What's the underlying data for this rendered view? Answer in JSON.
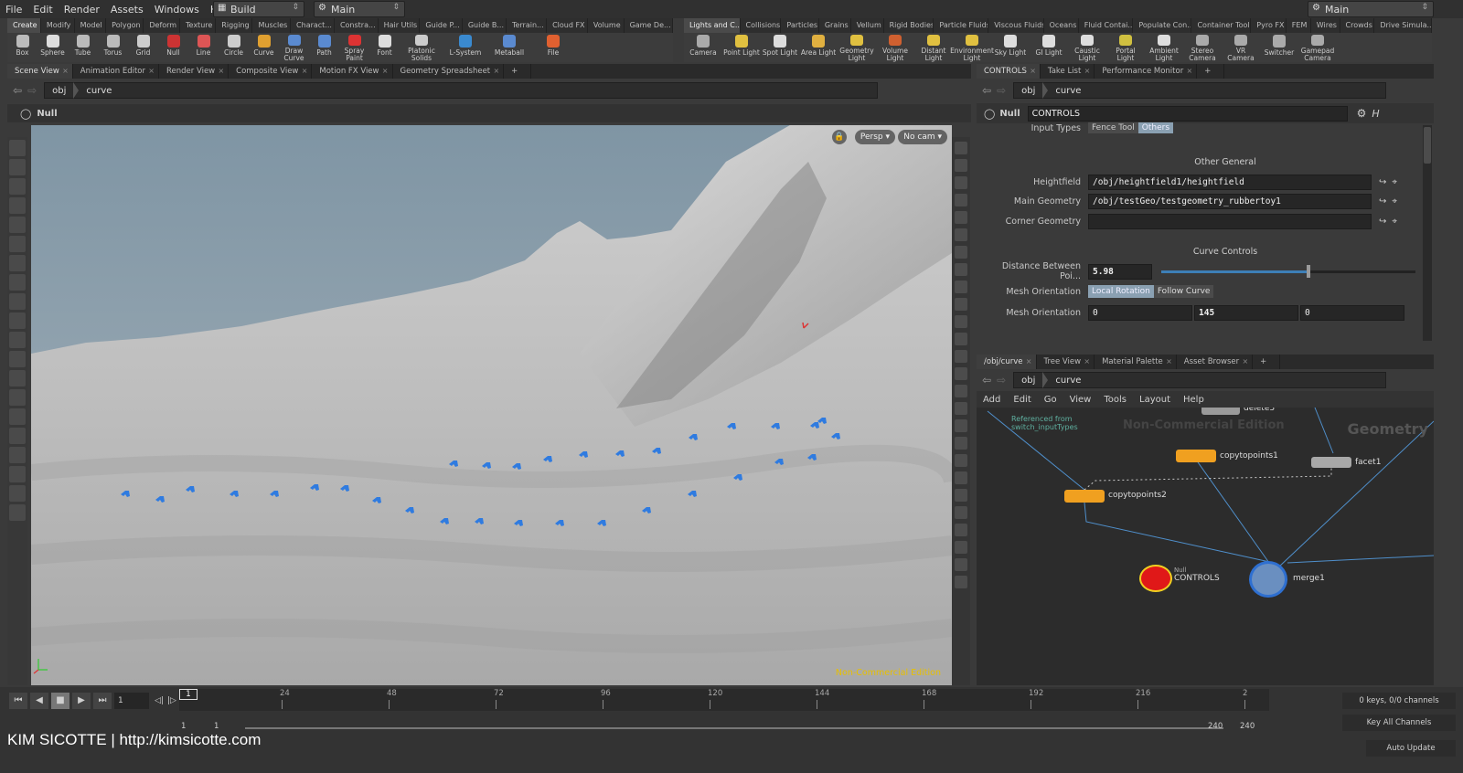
{
  "menu": [
    "File",
    "Edit",
    "Render",
    "Assets",
    "Windows",
    "Help"
  ],
  "desktop_dd": "Build",
  "context_dd": "Main",
  "right_dd": "Main",
  "shelf_left_tabs": [
    "Create",
    "Modify",
    "Model",
    "Polygon",
    "Deform",
    "Texture",
    "Rigging",
    "Muscles",
    "Charact...",
    "Constra...",
    "Hair Utils",
    "Guide P...",
    "Guide B...",
    "Terrain...",
    "Cloud FX",
    "Volume",
    "Game De..."
  ],
  "shelf_right_tabs": [
    "Lights and C...",
    "Collisions",
    "Particles",
    "Grains",
    "Vellum",
    "Rigid Bodies",
    "Particle Fluids",
    "Viscous Fluids",
    "Oceans",
    "Fluid Contai...",
    "Populate Con...",
    "Container Tools",
    "Pyro FX",
    "FEM",
    "Wires",
    "Crowds",
    "Drive Simula..."
  ],
  "tools_left": [
    "Box",
    "Sphere",
    "Tube",
    "Torus",
    "Grid",
    "Null",
    "Line",
    "Circle",
    "Curve",
    "Draw Curve",
    "Path",
    "Spray Paint",
    "Font",
    "Platonic Solids",
    "L-System",
    "Metaball",
    "File"
  ],
  "tools_right": [
    "Camera",
    "Point Light",
    "Spot Light",
    "Area Light",
    "Geometry Light",
    "Volume Light",
    "Distant Light",
    "Environment Light",
    "Sky Light",
    "GI Light",
    "Caustic Light",
    "Portal Light",
    "Ambient Light",
    "Stereo Camera",
    "VR Camera",
    "Switcher",
    "Gamepad Camera"
  ],
  "scene_tabs": [
    "Scene View",
    "Animation Editor",
    "Render View",
    "Composite View",
    "Motion FX View",
    "Geometry Spreadsheet"
  ],
  "path_obj": "obj",
  "path_curve": "curve",
  "viewer_op": "Null",
  "persp": "Persp ▾",
  "nocam": "No cam ▾",
  "watermark": "Non-Commercial Edition",
  "params_tabs": [
    "CONTROLS",
    "Take List",
    "Performance Monitor"
  ],
  "node_type": "Null",
  "node_name": "CONTROLS",
  "input_types_label": "Input Types",
  "input_types_opts": [
    "Fence Tool",
    "Others"
  ],
  "other_general": "Other General",
  "heightfield_label": "Heightfield",
  "heightfield_val": "/obj/heightfield1/heightfield",
  "main_geo_label": "Main Geometry",
  "main_geo_val": "/obj/testGeo/testgeometry_rubbertoy1",
  "corner_geo_label": "Corner Geometry",
  "corner_geo_val": "",
  "curve_controls": "Curve Controls",
  "dist_label": "Distance Between Poi...",
  "dist_val": "5.98",
  "dist_frac": 0.58,
  "mesh_orient_label": "Mesh Orientation",
  "mesh_orient_opts": [
    "Local Rotation",
    "Follow Curve"
  ],
  "mesh_orient2_label": "Mesh Orientation",
  "mesh_vec": [
    "0",
    "145",
    "0"
  ],
  "net_tabs": [
    "/obj/curve",
    "Tree View",
    "Material Palette",
    "Asset Browser"
  ],
  "net_menu": [
    "Add",
    "Edit",
    "Go",
    "View",
    "Tools",
    "Layout",
    "Help"
  ],
  "net_watermark": "Non-Commercial Edition",
  "net_context": "Geometry",
  "nodes": {
    "delete": "delete3",
    "ref": "Referenced from switch_inputTypes",
    "ctp1": "copytopoints1",
    "facet": "facet1",
    "ctp2": "copytopoints2",
    "controls_type": "Null",
    "controls": "CONTROLS",
    "merge": "merge1"
  },
  "timeline_ticks": [
    "24",
    "48",
    "72",
    "96",
    "120",
    "144",
    "168",
    "192",
    "216",
    "2"
  ],
  "frame": "1",
  "frame_marker": "1",
  "range_start": "1",
  "range_start2": "1",
  "range_end": "240",
  "range_end2": "240",
  "keys_info": "0 keys, 0/0 channels",
  "key_all": "Key All Channels",
  "auto_update": "Auto Update",
  "credit": "KIM SICOTTE | http://kimsicotte.com"
}
